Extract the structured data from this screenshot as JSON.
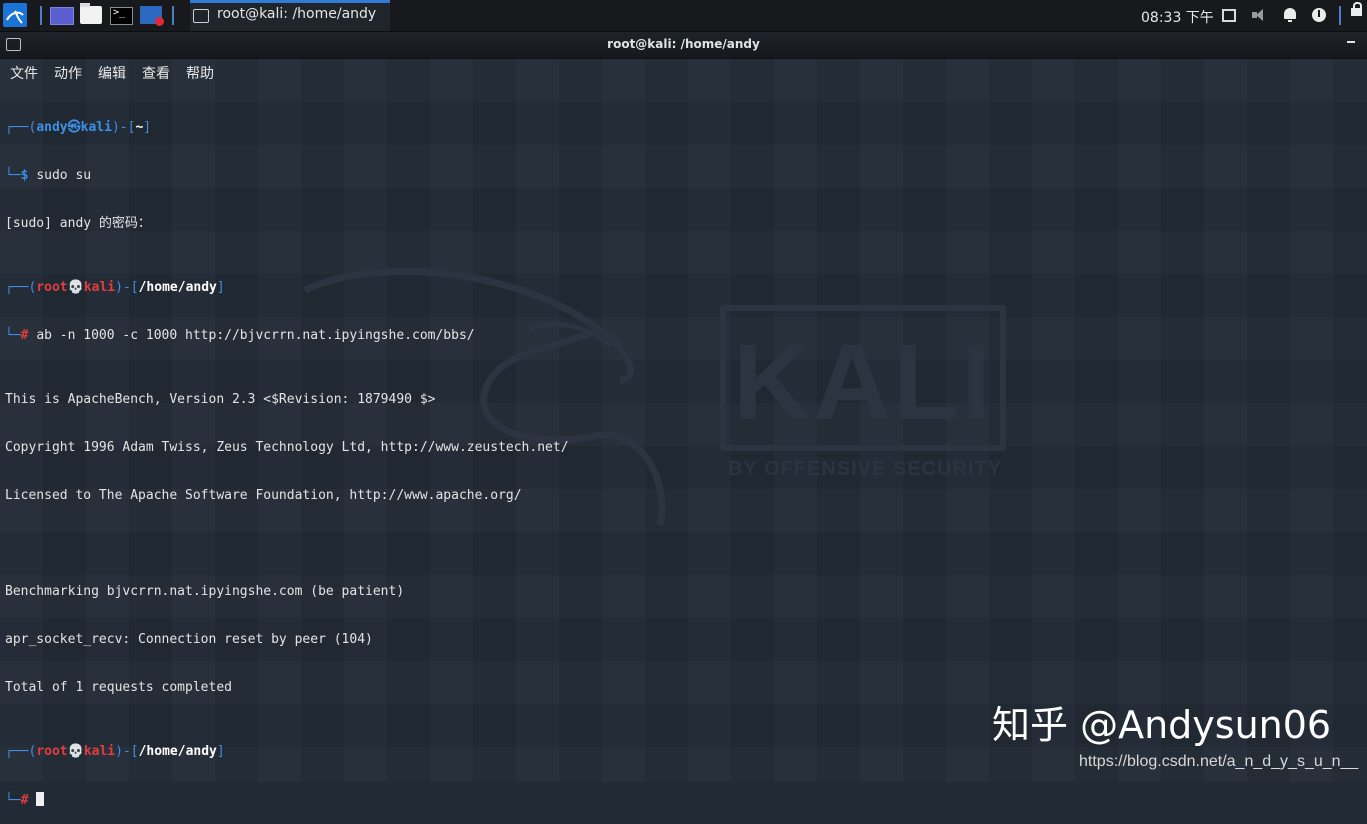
{
  "taskbar": {
    "window_title": "root@kali: /home/andy",
    "clock": "08:33 下午"
  },
  "window": {
    "title": "root@kali: /home/andy"
  },
  "menubar": {
    "items": [
      "文件",
      "动作",
      "编辑",
      "查看",
      "帮助"
    ]
  },
  "terminal": {
    "prompt1": {
      "user": "andy",
      "host": "kali",
      "path": "~",
      "symbol": "$",
      "command": "sudo su"
    },
    "sudo_line": "[sudo] andy 的密码：",
    "prompt2": {
      "user": "root",
      "host": "kali",
      "path": "/home/andy",
      "symbol": "#",
      "command": "ab -n 1000 -c 1000 http://bjvcrrn.nat.ipyingshe.com/bbs/"
    },
    "output": [
      "This is ApacheBench, Version 2.3 <$Revision: 1879490 $>",
      "Copyright 1996 Adam Twiss, Zeus Technology Ltd, http://www.zeustech.net/",
      "Licensed to The Apache Software Foundation, http://www.apache.org/",
      "",
      "Benchmarking bjvcrrn.nat.ipyingshe.com (be patient)",
      "apr_socket_recv: Connection reset by peer (104)",
      "Total of 1 requests completed"
    ],
    "prompt3": {
      "user": "root",
      "host": "kali",
      "path": "/home/andy",
      "symbol": "#"
    }
  },
  "wallpaper": {
    "logo": "KALI",
    "tagline": "BY OFFENSIVE SECURITY"
  },
  "watermarks": {
    "zhihu": "知乎 @Andysun06",
    "csdn": "https://blog.csdn.net/a_n_d_y_s_u_n__"
  },
  "colors": {
    "prompt_blue": "#3d8fe8",
    "root_red": "#e23d3d",
    "background": "#222b36",
    "taskbar_accent": "#2f7bd6"
  },
  "icons": [
    "kali-menu-icon",
    "show-desktop-icon",
    "file-manager-icon",
    "terminal-icon",
    "screen-recorder-icon",
    "display-icon",
    "volume-icon",
    "notification-bell-icon",
    "power-icon",
    "lock-icon"
  ]
}
